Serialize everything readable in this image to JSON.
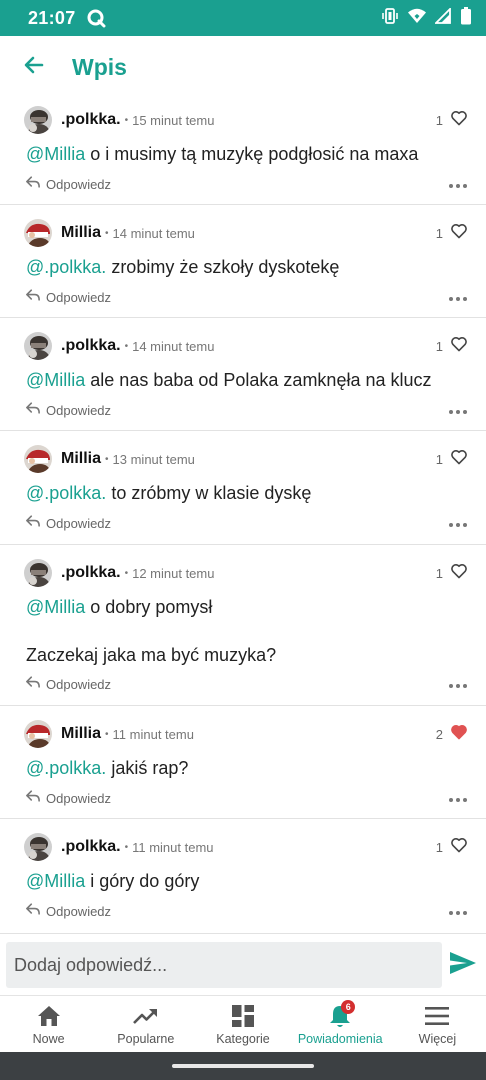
{
  "status_bar": {
    "time": "21:07",
    "icons": [
      "q-app-icon",
      "vibrate-icon",
      "wifi-icon",
      "signal-icon",
      "battery-icon"
    ]
  },
  "header": {
    "title": "Wpis",
    "back_icon": "arrow-left-icon"
  },
  "colors": {
    "accent": "#1aa090",
    "like_active": "#e05252",
    "badge": "#d32f2f"
  },
  "comments": [
    {
      "author": ".polkka.",
      "time": "15 minut temu",
      "likes": "1",
      "liked": false,
      "mention": "@Millia",
      "text": " o i musimy tą muzykę podgłosić na maxa",
      "text2": "",
      "reply_label": "Odpowiedz",
      "avatar": "polkka"
    },
    {
      "author": "Millia",
      "time": "14 minut temu",
      "likes": "1",
      "liked": false,
      "mention": "@.polkka.",
      "text": " zrobimy że szkoły dyskotekę",
      "text2": "",
      "reply_label": "Odpowiedz",
      "avatar": "millia"
    },
    {
      "author": ".polkka.",
      "time": "14 minut temu",
      "likes": "1",
      "liked": false,
      "mention": "@Millia",
      "text": " ale nas baba od Polaka zamknęła na klucz",
      "text2": "",
      "reply_label": "Odpowiedz",
      "avatar": "polkka"
    },
    {
      "author": "Millia",
      "time": "13 minut temu",
      "likes": "1",
      "liked": false,
      "mention": "@.polkka.",
      "text": " to zróbmy w klasie dyskę",
      "text2": "",
      "reply_label": "Odpowiedz",
      "avatar": "millia"
    },
    {
      "author": ".polkka.",
      "time": "12 minut temu",
      "likes": "1",
      "liked": false,
      "mention": "@Millia",
      "text": " o dobry pomysł",
      "text2": "Zaczekaj jaka ma być muzyka?",
      "reply_label": "Odpowiedz",
      "avatar": "polkka"
    },
    {
      "author": "Millia",
      "time": "11 minut temu",
      "likes": "2",
      "liked": true,
      "mention": "@.polkka.",
      "text": " jakiś rap?",
      "text2": "",
      "reply_label": "Odpowiedz",
      "avatar": "millia"
    },
    {
      "author": ".polkka.",
      "time": "11 minut temu",
      "likes": "1",
      "liked": false,
      "mention": "@Millia",
      "text": " i góry do góry",
      "text2": "",
      "reply_label": "Odpowiedz",
      "avatar": "polkka"
    }
  ],
  "composer": {
    "placeholder": "Dodaj odpowiedź..."
  },
  "bottom_nav": {
    "items": [
      {
        "label": "Nowe",
        "icon": "home-icon",
        "active": false
      },
      {
        "label": "Popularne",
        "icon": "trending-icon",
        "active": false
      },
      {
        "label": "Kategorie",
        "icon": "dashboard-icon",
        "active": false
      },
      {
        "label": "Powiadomienia",
        "icon": "bell-icon",
        "active": true,
        "badge": "6"
      },
      {
        "label": "Więcej",
        "icon": "menu-icon",
        "active": false
      }
    ]
  }
}
